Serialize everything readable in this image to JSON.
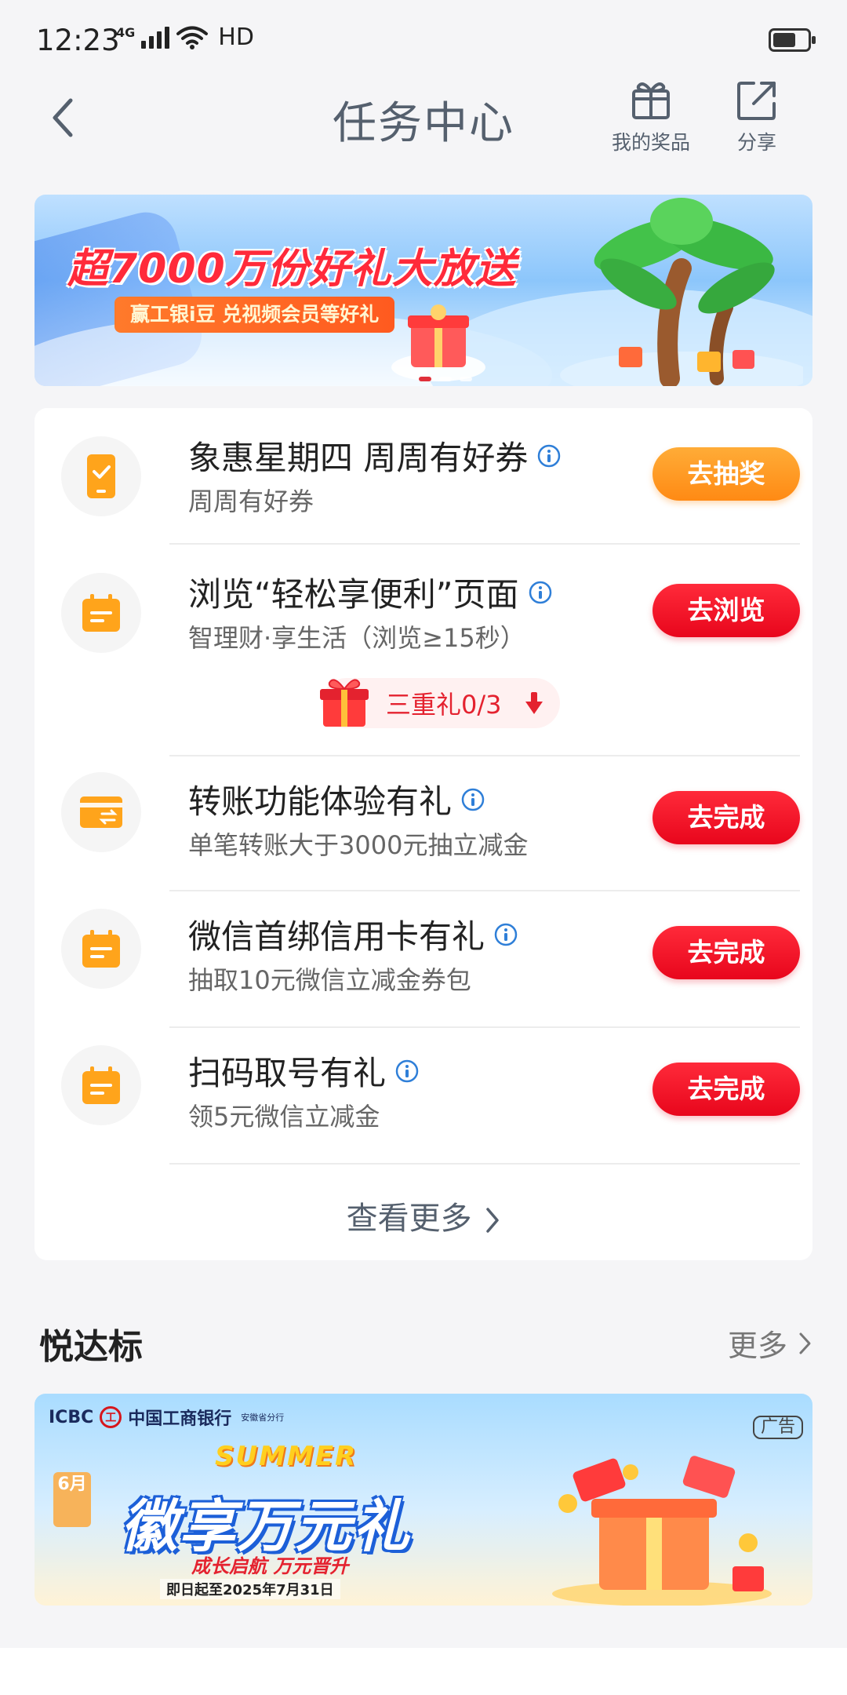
{
  "status_bar": {
    "time": "12:23",
    "network": "4G",
    "hd": "HD"
  },
  "header": {
    "title": "任务中心",
    "prizes_label": "我的奖品",
    "share_label": "分享"
  },
  "banner": {
    "headline": "超7000万份好礼大放送",
    "pill_text": "赢工银i豆 兑视频会员等好礼"
  },
  "tasks": [
    {
      "title": "象惠星期四 周周有好券",
      "subtitle": "周周有好券",
      "button": "去抽奖",
      "button_style": "orange",
      "icon": "phone-check-icon"
    },
    {
      "title": "浏览“轻松享便利”页面",
      "subtitle": "智理财·享生活（浏览≥15秒）",
      "button": "去浏览",
      "button_style": "red",
      "icon": "calendar-icon"
    },
    {
      "title": "转账功能体验有礼",
      "subtitle": "单笔转账大于3000元抽立减金",
      "button": "去完成",
      "button_style": "red",
      "icon": "card-transfer-icon"
    },
    {
      "title": "微信首绑信用卡有礼",
      "subtitle": "抽取10元微信立减金券包",
      "button": "去完成",
      "button_style": "red",
      "icon": "calendar-icon"
    },
    {
      "title": "扫码取号有礼",
      "subtitle": "领5元微信立减金",
      "button": "去完成",
      "button_style": "red",
      "icon": "calendar-icon"
    }
  ],
  "triple_gift": {
    "label": "三重礼0/3"
  },
  "see_more": "查看更多",
  "section": {
    "title": "悦达标",
    "more": "更多"
  },
  "ad": {
    "brand": "ICBC",
    "logo_char": "工",
    "bank": "中国工商银行",
    "branch": "安徽省分行",
    "tag": "广告",
    "summer": "SUMMER",
    "month": "6月",
    "headline": "徽享万元礼",
    "slogan": "成长启航 万元晋升",
    "date": "即日起至2025年7月31日"
  },
  "colors": {
    "accent_red": "#e8061c",
    "accent_orange": "#ff8a14",
    "icon_orange": "#ffa41b"
  }
}
